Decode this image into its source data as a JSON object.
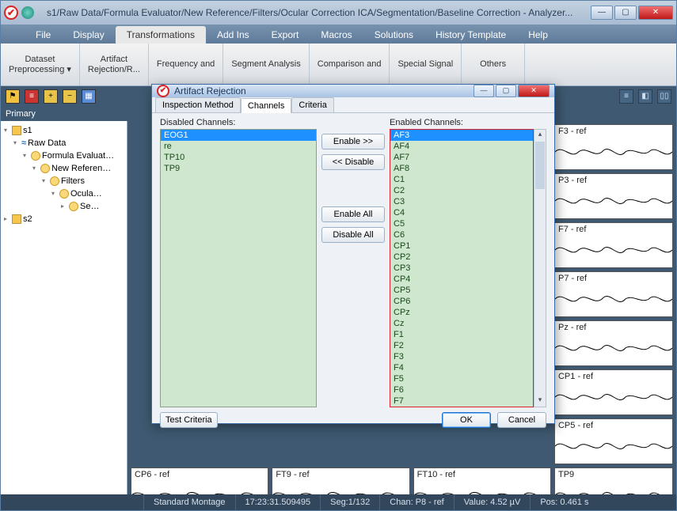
{
  "window": {
    "title": "s1/Raw Data/Formula Evaluator/New Reference/Filters/Ocular Correction ICA/Segmentation/Baseline Correction - Analyzer...",
    "min": "—",
    "max": "▢",
    "close": "✕"
  },
  "menu": {
    "items": [
      "File",
      "Display",
      "Transformations",
      "Add Ins",
      "Export",
      "Macros",
      "Solutions",
      "History Template",
      "Help"
    ],
    "active": 2
  },
  "ribbon": {
    "groups": [
      {
        "label": "Dataset\nPreprocessing ▾"
      },
      {
        "label": "Artifact\nRejection/R..."
      },
      {
        "label": "Frequency and"
      },
      {
        "label": "Segment Analysis"
      },
      {
        "label": "Comparison and"
      },
      {
        "label": "Special Signal"
      },
      {
        "label": "Others"
      }
    ]
  },
  "primary": {
    "label": "Primary"
  },
  "tree": [
    {
      "d": 0,
      "icon": "fold",
      "t": "s1",
      "exp": true
    },
    {
      "d": 1,
      "icon": "wave",
      "t": "Raw Data",
      "exp": true
    },
    {
      "d": 2,
      "icon": "gear",
      "t": "Formula Evaluat…",
      "exp": true
    },
    {
      "d": 3,
      "icon": "gear",
      "t": "New Referen…",
      "exp": true
    },
    {
      "d": 4,
      "icon": "gear",
      "t": "Filters",
      "exp": true
    },
    {
      "d": 5,
      "icon": "gear",
      "t": "Ocula…",
      "exp": true
    },
    {
      "d": 6,
      "icon": "gear",
      "t": "Se…",
      "exp": false
    },
    {
      "d": 0,
      "icon": "fold",
      "t": "s2",
      "exp": false
    }
  ],
  "plots_right": [
    "F3 - ref",
    "P3 - ref",
    "F7 - ref",
    "P7 - ref",
    "Pz - ref",
    "CP1 - ref",
    "CP5 - ref"
  ],
  "plots_bottom": [
    "CP6 - ref",
    "FT9 - ref",
    "FT10 - ref",
    "TP9"
  ],
  "status": {
    "montage": "Standard Montage",
    "time": "17:23:31.509495",
    "seg": "Seg:1/132",
    "chan": "Chan:  P8 - ref",
    "value": "Value:  4.52 µV",
    "pos": "Pos:  0.461 s"
  },
  "dialog": {
    "title": "Artifact Rejection",
    "tabs": [
      "Inspection Method",
      "Channels",
      "Criteria"
    ],
    "active_tab": 1,
    "disabled_label": "Disabled Channels:",
    "enabled_label": "Enabled Channels:",
    "disabled": [
      "EOG1",
      "re",
      "TP10",
      "TP9"
    ],
    "disabled_sel": 0,
    "enabled": [
      "AF3",
      "AF4",
      "AF7",
      "AF8",
      "C1",
      "C2",
      "C3",
      "C4",
      "C5",
      "C6",
      "CP1",
      "CP2",
      "CP3",
      "CP4",
      "CP5",
      "CP6",
      "CPz",
      "Cz",
      "F1",
      "F2",
      "F3",
      "F4",
      "F5",
      "F6",
      "F7"
    ],
    "enabled_sel": 0,
    "btn_enable": "Enable >>",
    "btn_disable": "<< Disable",
    "btn_enable_all": "Enable All",
    "btn_disable_all": "Disable All",
    "btn_test": "Test Criteria",
    "btn_ok": "OK",
    "btn_cancel": "Cancel"
  }
}
